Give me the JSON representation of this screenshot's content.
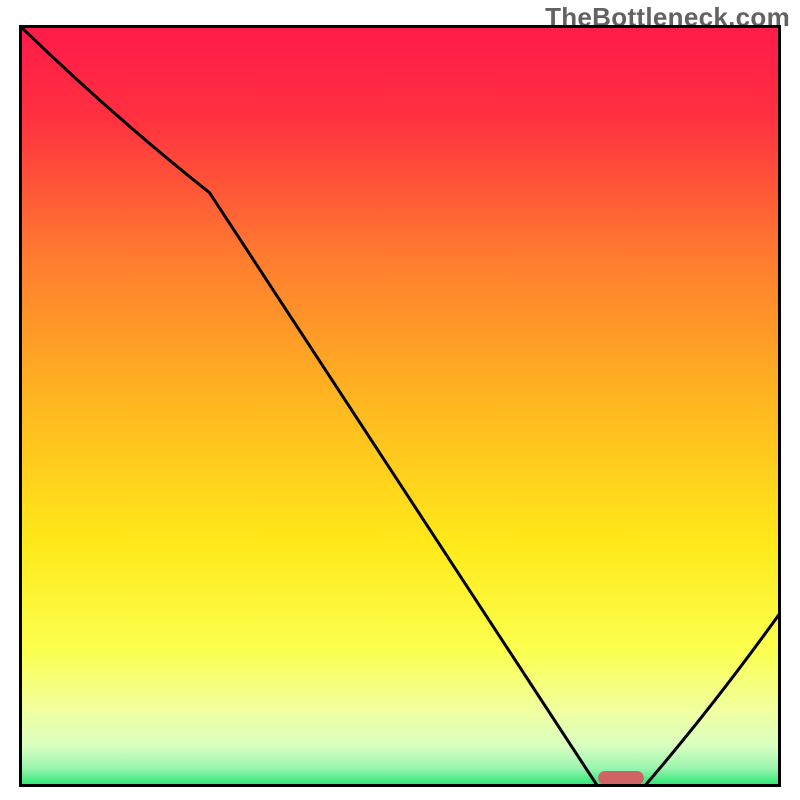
{
  "watermark": "TheBottleneck.com",
  "chart_data": {
    "type": "line",
    "title": "",
    "xlabel": "",
    "ylabel": "",
    "xlim": [
      0,
      100
    ],
    "ylim": [
      0,
      100
    ],
    "grid": false,
    "series": [
      {
        "name": "curve",
        "x": [
          0,
          25,
          76,
          82,
          100
        ],
        "y": [
          100,
          78,
          0,
          0,
          23
        ]
      }
    ],
    "optimal_marker": {
      "x_start": 76,
      "x_end": 82,
      "y": 0
    },
    "gradient_stops": [
      {
        "offset": 0.0,
        "color": "#ff1a4a"
      },
      {
        "offset": 0.12,
        "color": "#ff3040"
      },
      {
        "offset": 0.3,
        "color": "#ff7a30"
      },
      {
        "offset": 0.5,
        "color": "#ffb820"
      },
      {
        "offset": 0.68,
        "color": "#ffe91a"
      },
      {
        "offset": 0.82,
        "color": "#fbff4e"
      },
      {
        "offset": 0.9,
        "color": "#f1ffa0"
      },
      {
        "offset": 0.945,
        "color": "#d9ffc0"
      },
      {
        "offset": 0.975,
        "color": "#9cf5b0"
      },
      {
        "offset": 1.0,
        "color": "#1ee66f"
      }
    ],
    "frame_color": "#000000",
    "curve_color": "#000000",
    "marker_color": "#d06464"
  }
}
